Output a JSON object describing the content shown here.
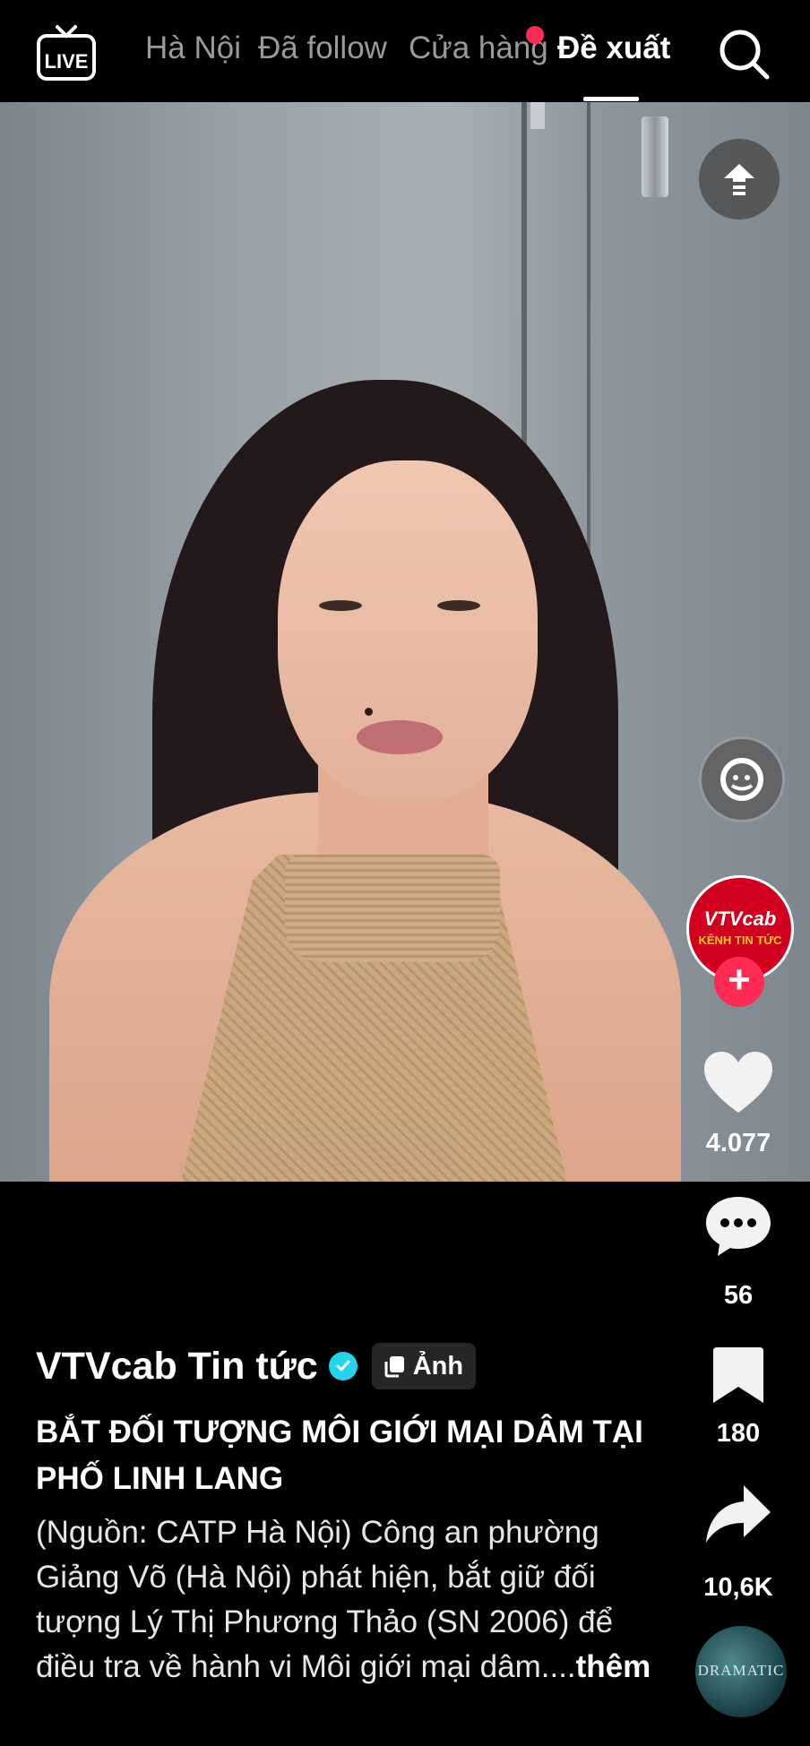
{
  "topbar": {
    "live_label": "LIVE",
    "tabs": [
      {
        "label": "Hà Nội"
      },
      {
        "label": "Đã follow"
      },
      {
        "label": "Cửa hàng"
      },
      {
        "label": "Đề xuất"
      }
    ],
    "active_tab": "Đề xuất",
    "notification_color": "#fe2c55"
  },
  "rail": {
    "avatar_title": "VTVcab",
    "avatar_subtitle": "KÊNH TIN TỨC",
    "likes": "4.077",
    "comments": "56",
    "saves": "180",
    "shares": "10,6K",
    "music_disc_text": "DRAMATIC"
  },
  "post": {
    "author": "VTVcab Tin tức",
    "badge_label": "Ảnh",
    "title": "BẮT ĐỐI TƯỢNG MÔI GIỚI MẠI DÂM TẠI PHỐ LINH LANG",
    "description": "(Nguồn: CATP Hà Nội) Công an phường Giảng Võ (Hà Nội) phát hiện, bắt giữ đối tượng Lý Thị Phương Thảo (SN 2006) để điều tra về hành vi Môi giới mại dâm....",
    "more_label": "thêm"
  },
  "colors": {
    "accent": "#fe2c55",
    "verified": "#20d5ec",
    "background": "#000000"
  },
  "icons": [
    "live-icon",
    "search-icon",
    "upload-icon",
    "face-icon",
    "heart-icon",
    "comment-icon",
    "bookmark-icon",
    "share-icon",
    "photo-icon",
    "verified-icon"
  ]
}
